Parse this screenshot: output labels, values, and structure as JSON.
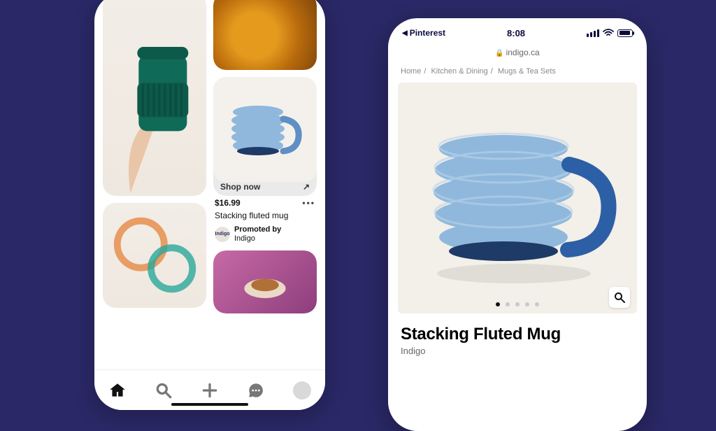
{
  "pinterest": {
    "shop_now_label": "Shop now",
    "price": "$16.99",
    "product_title": "Stacking fluted mug",
    "promoted_label": "Promoted by",
    "promoter": "Indigo",
    "promoter_badge": "Indigo",
    "tabs": [
      "home",
      "search",
      "create",
      "inbox",
      "profile"
    ]
  },
  "safari": {
    "back_app": "Pinterest",
    "clock": "8:08",
    "domain": "indigo.ca",
    "breadcrumbs": [
      "Home",
      "Kitchen & Dining",
      "Mugs & Tea Sets"
    ],
    "product_title": "Stacking Fluted Mug",
    "brand": "Indigo",
    "gallery_count": 5,
    "gallery_active": 0
  },
  "colors": {
    "bg": "#2a2866",
    "mug_blue": "#8fb8dc",
    "mug_blue_dark": "#1e3a66"
  }
}
